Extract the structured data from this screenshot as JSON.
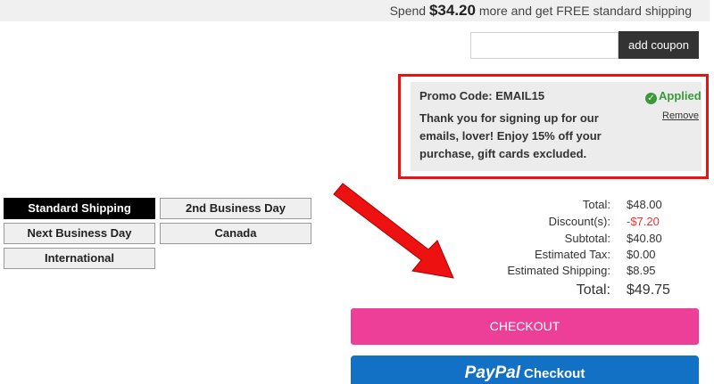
{
  "banner": {
    "prefix": "Spend ",
    "amount": "$34.20",
    "suffix": " more and get FREE standard shipping"
  },
  "coupon": {
    "input_value": "",
    "button_label": "add coupon"
  },
  "promo": {
    "title": "Promo Code: EMAIL15",
    "status": "Applied",
    "remove_label": "Remove",
    "message": "Thank you for signing up for our emails, lover! Enjoy 15% off your purchase, gift cards excluded."
  },
  "shipping_options": {
    "standard": "Standard Shipping",
    "second_day": "2nd Business Day",
    "next_day": "Next Business Day",
    "canada": "Canada",
    "international": "International",
    "selected": "Standard Shipping"
  },
  "summary": {
    "total_label": "Total:",
    "total_value": "$48.00",
    "discount_label": "Discount(s):",
    "discount_value": "-$7.20",
    "subtotal_label": "Subtotal:",
    "subtotal_value": "$40.80",
    "tax_label": "Estimated Tax:",
    "tax_value": "$0.00",
    "shipping_label": "Estimated Shipping:",
    "shipping_value": "$8.95",
    "grand_total_label": "Total:",
    "grand_total_value": "$49.75"
  },
  "actions": {
    "checkout_label": "CHECKOUT",
    "paypal_brand": "PayPal",
    "paypal_label": "Checkout"
  },
  "colors": {
    "checkout_pink": "#ee3f98",
    "paypal_blue": "#1271c4",
    "applied_green": "#3a9a3a",
    "highlight_red": "#e11111",
    "discount_red": "#e33333"
  }
}
